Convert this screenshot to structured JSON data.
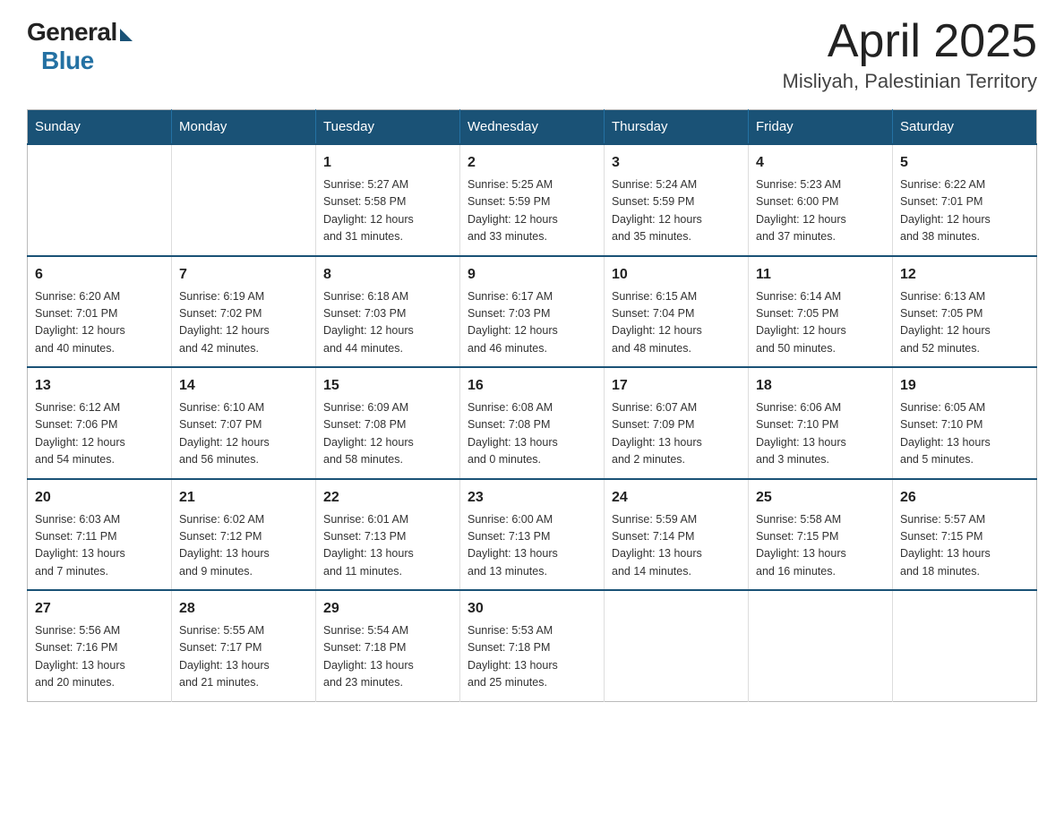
{
  "header": {
    "logo": {
      "general": "General",
      "blue": "Blue",
      "tagline": ""
    },
    "title": "April 2025",
    "subtitle": "Misliyah, Palestinian Territory"
  },
  "calendar": {
    "weekdays": [
      "Sunday",
      "Monday",
      "Tuesday",
      "Wednesday",
      "Thursday",
      "Friday",
      "Saturday"
    ],
    "weeks": [
      [
        {
          "day": "",
          "info": ""
        },
        {
          "day": "",
          "info": ""
        },
        {
          "day": "1",
          "info": "Sunrise: 5:27 AM\nSunset: 5:58 PM\nDaylight: 12 hours\nand 31 minutes."
        },
        {
          "day": "2",
          "info": "Sunrise: 5:25 AM\nSunset: 5:59 PM\nDaylight: 12 hours\nand 33 minutes."
        },
        {
          "day": "3",
          "info": "Sunrise: 5:24 AM\nSunset: 5:59 PM\nDaylight: 12 hours\nand 35 minutes."
        },
        {
          "day": "4",
          "info": "Sunrise: 5:23 AM\nSunset: 6:00 PM\nDaylight: 12 hours\nand 37 minutes."
        },
        {
          "day": "5",
          "info": "Sunrise: 6:22 AM\nSunset: 7:01 PM\nDaylight: 12 hours\nand 38 minutes."
        }
      ],
      [
        {
          "day": "6",
          "info": "Sunrise: 6:20 AM\nSunset: 7:01 PM\nDaylight: 12 hours\nand 40 minutes."
        },
        {
          "day": "7",
          "info": "Sunrise: 6:19 AM\nSunset: 7:02 PM\nDaylight: 12 hours\nand 42 minutes."
        },
        {
          "day": "8",
          "info": "Sunrise: 6:18 AM\nSunset: 7:03 PM\nDaylight: 12 hours\nand 44 minutes."
        },
        {
          "day": "9",
          "info": "Sunrise: 6:17 AM\nSunset: 7:03 PM\nDaylight: 12 hours\nand 46 minutes."
        },
        {
          "day": "10",
          "info": "Sunrise: 6:15 AM\nSunset: 7:04 PM\nDaylight: 12 hours\nand 48 minutes."
        },
        {
          "day": "11",
          "info": "Sunrise: 6:14 AM\nSunset: 7:05 PM\nDaylight: 12 hours\nand 50 minutes."
        },
        {
          "day": "12",
          "info": "Sunrise: 6:13 AM\nSunset: 7:05 PM\nDaylight: 12 hours\nand 52 minutes."
        }
      ],
      [
        {
          "day": "13",
          "info": "Sunrise: 6:12 AM\nSunset: 7:06 PM\nDaylight: 12 hours\nand 54 minutes."
        },
        {
          "day": "14",
          "info": "Sunrise: 6:10 AM\nSunset: 7:07 PM\nDaylight: 12 hours\nand 56 minutes."
        },
        {
          "day": "15",
          "info": "Sunrise: 6:09 AM\nSunset: 7:08 PM\nDaylight: 12 hours\nand 58 minutes."
        },
        {
          "day": "16",
          "info": "Sunrise: 6:08 AM\nSunset: 7:08 PM\nDaylight: 13 hours\nand 0 minutes."
        },
        {
          "day": "17",
          "info": "Sunrise: 6:07 AM\nSunset: 7:09 PM\nDaylight: 13 hours\nand 2 minutes."
        },
        {
          "day": "18",
          "info": "Sunrise: 6:06 AM\nSunset: 7:10 PM\nDaylight: 13 hours\nand 3 minutes."
        },
        {
          "day": "19",
          "info": "Sunrise: 6:05 AM\nSunset: 7:10 PM\nDaylight: 13 hours\nand 5 minutes."
        }
      ],
      [
        {
          "day": "20",
          "info": "Sunrise: 6:03 AM\nSunset: 7:11 PM\nDaylight: 13 hours\nand 7 minutes."
        },
        {
          "day": "21",
          "info": "Sunrise: 6:02 AM\nSunset: 7:12 PM\nDaylight: 13 hours\nand 9 minutes."
        },
        {
          "day": "22",
          "info": "Sunrise: 6:01 AM\nSunset: 7:13 PM\nDaylight: 13 hours\nand 11 minutes."
        },
        {
          "day": "23",
          "info": "Sunrise: 6:00 AM\nSunset: 7:13 PM\nDaylight: 13 hours\nand 13 minutes."
        },
        {
          "day": "24",
          "info": "Sunrise: 5:59 AM\nSunset: 7:14 PM\nDaylight: 13 hours\nand 14 minutes."
        },
        {
          "day": "25",
          "info": "Sunrise: 5:58 AM\nSunset: 7:15 PM\nDaylight: 13 hours\nand 16 minutes."
        },
        {
          "day": "26",
          "info": "Sunrise: 5:57 AM\nSunset: 7:15 PM\nDaylight: 13 hours\nand 18 minutes."
        }
      ],
      [
        {
          "day": "27",
          "info": "Sunrise: 5:56 AM\nSunset: 7:16 PM\nDaylight: 13 hours\nand 20 minutes."
        },
        {
          "day": "28",
          "info": "Sunrise: 5:55 AM\nSunset: 7:17 PM\nDaylight: 13 hours\nand 21 minutes."
        },
        {
          "day": "29",
          "info": "Sunrise: 5:54 AM\nSunset: 7:18 PM\nDaylight: 13 hours\nand 23 minutes."
        },
        {
          "day": "30",
          "info": "Sunrise: 5:53 AM\nSunset: 7:18 PM\nDaylight: 13 hours\nand 25 minutes."
        },
        {
          "day": "",
          "info": ""
        },
        {
          "day": "",
          "info": ""
        },
        {
          "day": "",
          "info": ""
        }
      ]
    ]
  }
}
